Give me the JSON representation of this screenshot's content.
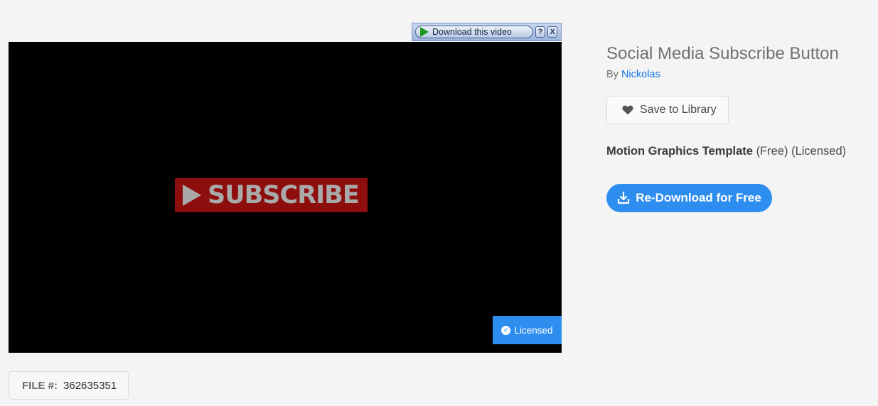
{
  "plugin_bar": {
    "download_label": "Download this video",
    "help_label": "?",
    "close_label": "X"
  },
  "video": {
    "overlay_text": "SUBSCRIBE",
    "licensed_badge": "Licensed"
  },
  "file": {
    "label": "FILE #:",
    "number": "362635351"
  },
  "asset": {
    "title": "Social Media Subscribe Button",
    "by_prefix": "By",
    "author": "Nickolas",
    "save_label": "Save to Library",
    "type": "Motion Graphics Template",
    "price_status": "(Free)",
    "license_status": "(Licensed)",
    "redownload_label": "Re-Download for Free"
  },
  "icons": {
    "play": "play-icon",
    "check": "check-circle-icon",
    "heart": "heart-icon",
    "download": "download-icon"
  },
  "colors": {
    "accent": "#2d8ef0",
    "link": "#1473e6",
    "subscribe_red": "#8e0d0d",
    "background": "#f4f4f4"
  }
}
